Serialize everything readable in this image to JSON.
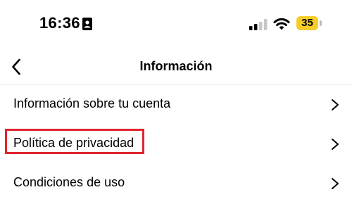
{
  "status_bar": {
    "time": "16:36",
    "battery_level": "35",
    "contact_icon": "contact-card-icon",
    "signal_icon": "cellular-signal-icon",
    "wifi_icon": "wifi-icon",
    "battery_color": "#f5cd2a"
  },
  "header": {
    "title": "Información",
    "back_icon": "chevron-left-icon"
  },
  "menu": {
    "items": [
      {
        "label": "Información sobre tu cuenta",
        "icon": "chevron-right-icon"
      },
      {
        "label": "Política de privacidad",
        "icon": "chevron-right-icon",
        "highlighted": true
      },
      {
        "label": "Condiciones de uso",
        "icon": "chevron-right-icon"
      }
    ],
    "highlight_color": "#e0252e"
  }
}
